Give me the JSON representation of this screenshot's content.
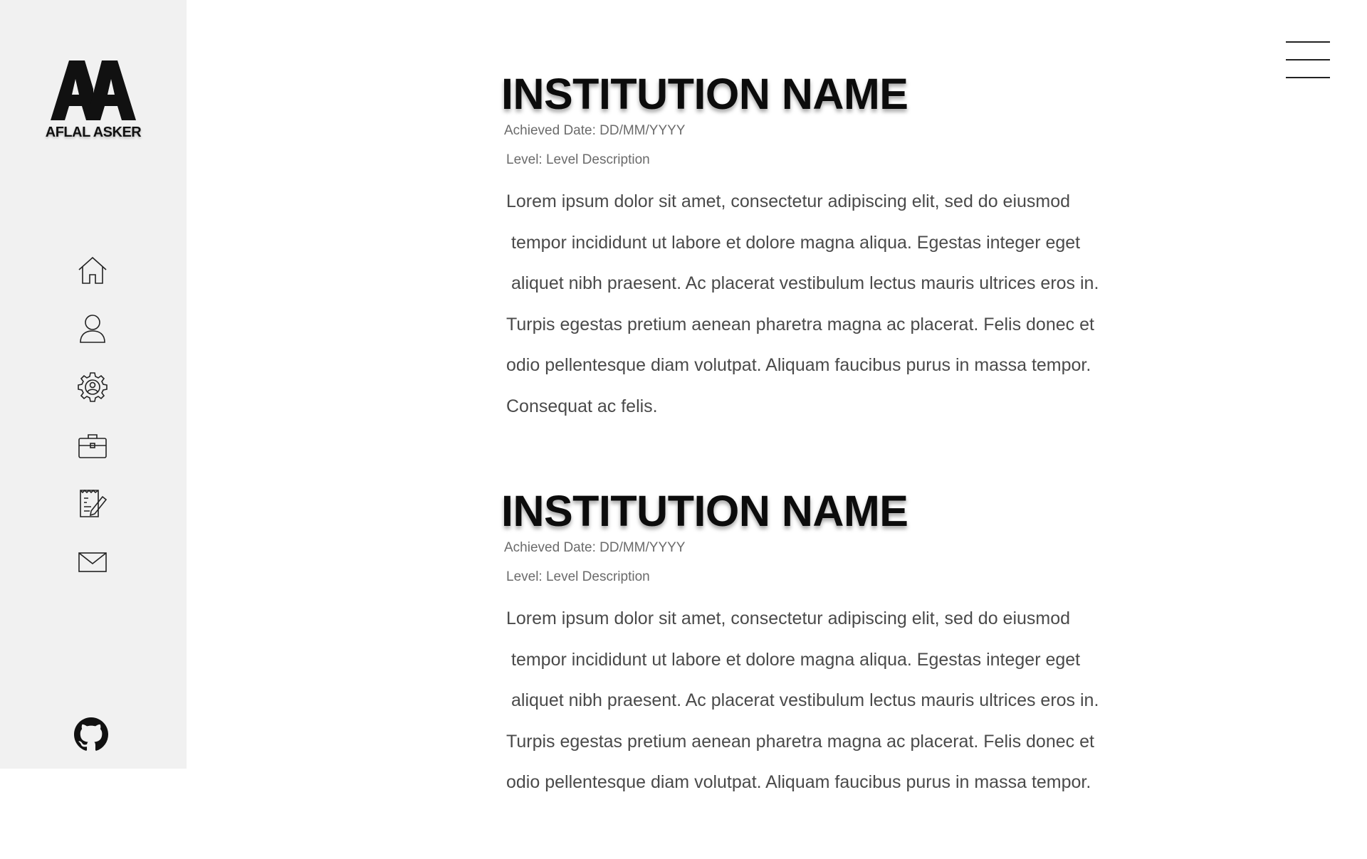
{
  "brand": {
    "logo_text": "AA",
    "name": "AFLAL ASKER"
  },
  "sidebar": {
    "items": [
      {
        "icon": "home-icon"
      },
      {
        "icon": "user-icon"
      },
      {
        "icon": "gear-icon"
      },
      {
        "icon": "briefcase-icon"
      },
      {
        "icon": "document-edit-icon"
      },
      {
        "icon": "mail-icon"
      }
    ],
    "footer_icon": "github-icon"
  },
  "header": {
    "menu_icon": "hamburger-menu-icon"
  },
  "entries": [
    {
      "title": "INSTITUTION NAME",
      "date": "Achieved Date: DD/MM/YYYY",
      "level": "Level: Level Description",
      "lines": [
        "Lorem ipsum dolor sit amet, consectetur adipiscing elit, sed do eiusmod",
        "tempor incididunt ut labore et dolore magna aliqua. Egestas integer eget",
        "aliquet nibh praesent. Ac placerat vestibulum lectus mauris ultrices eros in.",
        "Turpis egestas pretium aenean pharetra magna ac placerat. Felis donec et",
        "odio pellentesque diam volutpat. Aliquam faucibus purus in massa tempor.",
        "Consequat ac felis."
      ]
    },
    {
      "title": "INSTITUTION NAME",
      "date": "Achieved Date: DD/MM/YYYY",
      "level": "Level: Level Description",
      "lines": [
        "Lorem ipsum dolor sit amet, consectetur adipiscing elit, sed do eiusmod",
        "tempor incididunt ut labore et dolore magna aliqua. Egestas integer eget",
        "aliquet nibh praesent. Ac placerat vestibulum lectus mauris ultrices eros in.",
        "Turpis egestas pretium aenean pharetra magna ac placerat. Felis donec et",
        "odio pellentesque diam volutpat. Aliquam faucibus purus in massa tempor."
      ]
    }
  ],
  "colors": {
    "sidebar_bg": "#f1f1f1",
    "title": "#0c0c0c",
    "meta": "#6b6b6b",
    "body_text": "#4a4a4a"
  }
}
